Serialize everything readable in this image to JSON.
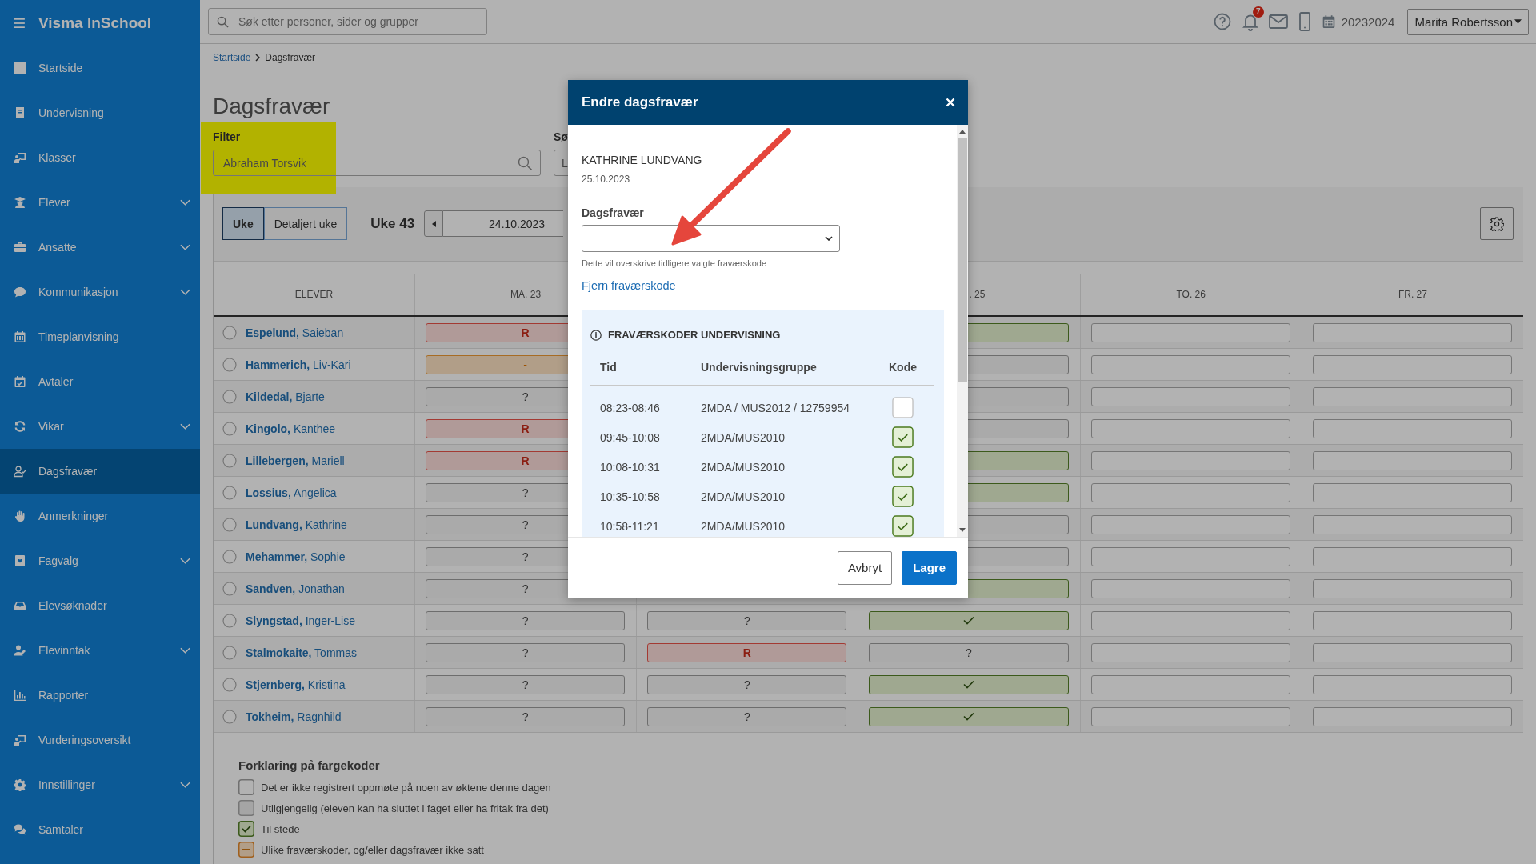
{
  "sidebar": {
    "title": "Visma InSchool",
    "items": [
      {
        "label": "Startside",
        "selected": false,
        "has_submenu": false
      },
      {
        "label": "Undervisning",
        "selected": false,
        "has_submenu": false
      },
      {
        "label": "Klasser",
        "selected": false,
        "has_submenu": false
      },
      {
        "label": "Elever",
        "selected": false,
        "has_submenu": true
      },
      {
        "label": "Ansatte",
        "selected": false,
        "has_submenu": true
      },
      {
        "label": "Kommunikasjon",
        "selected": false,
        "has_submenu": true
      },
      {
        "label": "Timeplanvisning",
        "selected": false,
        "has_submenu": false
      },
      {
        "label": "Avtaler",
        "selected": false,
        "has_submenu": false
      },
      {
        "label": "Vikar",
        "selected": false,
        "has_submenu": true
      },
      {
        "label": "Dagsfravær",
        "selected": true,
        "has_submenu": false
      },
      {
        "label": "Anmerkninger",
        "selected": false,
        "has_submenu": false
      },
      {
        "label": "Fagvalg",
        "selected": false,
        "has_submenu": true
      },
      {
        "label": "Elevsøknader",
        "selected": false,
        "has_submenu": false
      },
      {
        "label": "Elevinntak",
        "selected": false,
        "has_submenu": true
      },
      {
        "label": "Rapporter",
        "selected": false,
        "has_submenu": false
      },
      {
        "label": "Vurderingsoversikt",
        "selected": false,
        "has_submenu": false
      },
      {
        "label": "Innstillinger",
        "selected": false,
        "has_submenu": true
      },
      {
        "label": "Samtaler",
        "selected": false,
        "has_submenu": false
      }
    ]
  },
  "topbar": {
    "search": {
      "placeholder": "Søk etter personer, sider og grupper"
    },
    "notification_count": "7",
    "school_year": "20232024",
    "user": "Marita Robertsson"
  },
  "breadcrumb": [
    "Startside",
    "Dagsfravær"
  ],
  "page": {
    "title": "Dagsfravær",
    "filters": [
      {
        "label": "Filter",
        "value": "Abraham Torsvik",
        "kind": "search",
        "highlighted": true
      },
      {
        "label": "Sø",
        "value": "L",
        "kind": "text"
      }
    ]
  },
  "toolbar": {
    "views": [
      {
        "label": "Uke",
        "selected": true
      },
      {
        "label": "Detaljert uke",
        "selected": false
      }
    ],
    "week": "Uke 43",
    "date": "24.10.2023"
  },
  "table": {
    "columns": {
      "column_1": "ELEVER",
      "column_2": "MA. 23",
      "column_4": ". 25",
      "column_5": "TO. 26",
      "column_6": "FR. 27"
    },
    "rows": [
      {
        "name": "**Espelund,** Saieban",
        "selected": false,
        "column_2": {
          "kind": "absent",
          "code": "R"
        },
        "column_4": {
          "kind": "present"
        },
        "column_5": {
          "kind": "empty"
        },
        "column_6": {
          "kind": "empty"
        }
      },
      {
        "name": "**Hammerich,** Liv-Kari",
        "selected": false,
        "column_2": {
          "kind": "mixed",
          "code": "-"
        },
        "column_4": {
          "kind": "unregistered"
        },
        "column_5": {
          "kind": "empty"
        },
        "column_6": {
          "kind": "empty"
        }
      },
      {
        "name": "**Kildedal,** Bjarte",
        "selected": false,
        "column_2": {
          "kind": "unregistered",
          "code": "?"
        },
        "column_4": {
          "kind": "unregistered"
        },
        "column_5": {
          "kind": "empty"
        },
        "column_6": {
          "kind": "empty"
        }
      },
      {
        "name": "**Kingolo,** Kanthee",
        "selected": false,
        "column_2": {
          "kind": "absent",
          "code": "R"
        },
        "column_4": {
          "kind": "unregistered"
        },
        "column_5": {
          "kind": "empty"
        },
        "column_6": {
          "kind": "empty"
        }
      },
      {
        "name": "**Lillebergen,** Mariell",
        "selected": false,
        "column_2": {
          "kind": "absent",
          "code": "R"
        },
        "column_4": {
          "kind": "present"
        },
        "column_5": {
          "kind": "empty"
        },
        "column_6": {
          "kind": "empty"
        }
      },
      {
        "name": "**Lossius,** Angelica",
        "selected": false,
        "column_2": {
          "kind": "unregistered",
          "code": "?"
        },
        "column_4": {
          "kind": "present"
        },
        "column_5": {
          "kind": "empty"
        },
        "column_6": {
          "kind": "empty"
        }
      },
      {
        "name": "**Lundvang,** Kathrine",
        "selected": false,
        "column_2": {
          "kind": "unregistered",
          "code": "?"
        },
        "column_4": {
          "kind": "unregistered"
        },
        "column_5": {
          "kind": "empty"
        },
        "column_6": {
          "kind": "empty"
        }
      },
      {
        "name": "**Mehammer,** Sophie",
        "selected": false,
        "column_2": {
          "kind": "unregistered",
          "code": "?"
        },
        "column_4": {
          "kind": "unregistered"
        },
        "column_5": {
          "kind": "empty"
        },
        "column_6": {
          "kind": "empty"
        }
      },
      {
        "name": "**Sandven,** Jonathan",
        "selected": false,
        "column_2": {
          "kind": "unregistered",
          "code": "?"
        },
        "column_4": {
          "kind": "present"
        },
        "column_5": {
          "kind": "empty"
        },
        "column_6": {
          "kind": "empty"
        }
      },
      {
        "name": "**Slyngstad,** Inger-Lise",
        "selected": false,
        "column_2": {
          "kind": "unregistered",
          "code": "?"
        },
        "column_3": {
          "kind": "unregistered",
          "code": "?"
        },
        "column_4": {
          "kind": "present",
          "tick": true
        },
        "column_5": {
          "kind": "empty"
        },
        "column_6": {
          "kind": "empty"
        }
      },
      {
        "name": "**Stalmokaite,** Tommas",
        "selected": false,
        "column_2": {
          "kind": "unregistered",
          "code": "?"
        },
        "column_3": {
          "kind": "absent",
          "code": "R"
        },
        "column_4": {
          "kind": "unregistered",
          "code": "?"
        },
        "column_5": {
          "kind": "empty"
        },
        "column_6": {
          "kind": "empty"
        }
      },
      {
        "name": "**Stjernberg,** Kristina",
        "selected": false,
        "column_2": {
          "kind": "unregistered",
          "code": "?"
        },
        "column_3": {
          "kind": "unregistered",
          "code": "?"
        },
        "column_4": {
          "kind": "present",
          "tick": true
        },
        "column_5": {
          "kind": "empty"
        },
        "column_6": {
          "kind": "empty"
        }
      },
      {
        "name": "**Tokheim,** Ragnhild",
        "selected": false,
        "column_2": {
          "kind": "unregistered",
          "code": "?"
        },
        "column_3": {
          "kind": "unregistered",
          "code": "?"
        },
        "column_4": {
          "kind": "present",
          "tick": true
        },
        "column_5": {
          "kind": "empty"
        },
        "column_6": {
          "kind": "empty"
        }
      }
    ]
  },
  "legend": {
    "title": "Forklaring på fargekoder",
    "items": [
      {
        "kind": "unregistered",
        "text": "Det er ikke registrert oppmøte på noen av øktene denne dagen"
      },
      {
        "kind": "unavailable",
        "text": "Utilgjengelig (eleven kan ha sluttet i faget eller ha fritak fra det)"
      },
      {
        "kind": "present",
        "text": "Til stede"
      },
      {
        "kind": "mixed",
        "text": "Ulike fraværskoder, og/eller dagsfravær ikke satt"
      }
    ]
  },
  "dialog": {
    "title": "Endre dagsfravær",
    "student": "KATHRINE LUNDVANG",
    "date": "25.10.2023",
    "select": {
      "label": "Dagsfravær"
    },
    "hint": "Dette vil overskrive tidligere valgte fraværskode",
    "link": "Fjern fraværskode",
    "codes": {
      "title": "FRAVÆRSKODER UNDERVISNING",
      "columns": [
        "Tid",
        "Undervisningsgruppe",
        "Kode"
      ],
      "rows": [
        {
          "time": "08:23-08:46",
          "group": "2MDA / MUS2012 / 12759954",
          "checked": false
        },
        {
          "time": "09:45-10:08",
          "group": "2MDA/MUS2010",
          "checked": true
        },
        {
          "time": "10:08-10:31",
          "group": "2MDA/MUS2010",
          "checked": true
        },
        {
          "time": "10:35-10:58",
          "group": "2MDA/MUS2010",
          "checked": true
        },
        {
          "time": "10:58-11:21",
          "group": "2MDA/MUS2010",
          "checked": true
        }
      ]
    },
    "buttons": [
      {
        "label": "Avbryt",
        "kind": "secondary"
      },
      {
        "label": "Lagre",
        "kind": "primary"
      }
    ]
  }
}
